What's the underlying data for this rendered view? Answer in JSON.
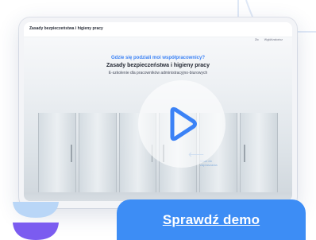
{
  "screen": {
    "course_title": "Zasady bezpieczeństwa i higieny pracy",
    "top_links": [
      "Zło",
      "Wyjdź/zakończ"
    ],
    "question": "Gdzie się podziali moi współpracownicy?",
    "title": "Zasady bezpieczeństwa i higieny pracy",
    "subtitle": "E-szkolenie dla pracowników administracyjno-biurowych",
    "back_label": "Wróć do zapraszania"
  },
  "play_button": {
    "icon": "play-icon",
    "color": "#3b82f6"
  },
  "cta": {
    "label": "Sprawdź demo",
    "color": "#3d8df5"
  },
  "brand": {
    "icon": "brand-logo-icon",
    "colors": [
      "#b9d6f7",
      "#7b5cf0"
    ]
  }
}
